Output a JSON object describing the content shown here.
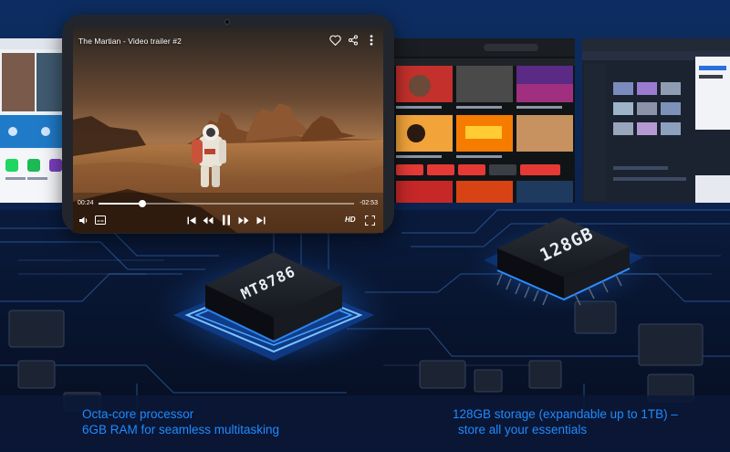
{
  "video": {
    "title": "The Martian - Video trailer #2",
    "current_time": "00:24",
    "remaining_time": "-02:53",
    "progress": 0.17,
    "quality_badge": "HD"
  },
  "chips": {
    "processor_label": "MT8786",
    "storage_label": "128GB"
  },
  "captions": {
    "left_line1": "Octa-core processor",
    "left_line2": "6GB RAM for seamless multitasking",
    "right_line1": "128GB storage (expandable up to 1TB) –",
    "right_line2": "store all your essentials"
  },
  "colors": {
    "caption": "#1f8bff",
    "glow": "#2e8cff",
    "board": "#0b1a33"
  },
  "icons": {
    "favorite": "heart-icon",
    "share": "share-icon",
    "menu": "more-vertical-icon",
    "volume": "volume-icon",
    "captions": "subtitles-icon",
    "skip_back": "skip-previous-icon",
    "rewind": "rewind-icon",
    "pause": "pause-icon",
    "forward": "fast-forward-icon",
    "skip_next": "skip-next-icon",
    "fullscreen": "fullscreen-icon"
  }
}
